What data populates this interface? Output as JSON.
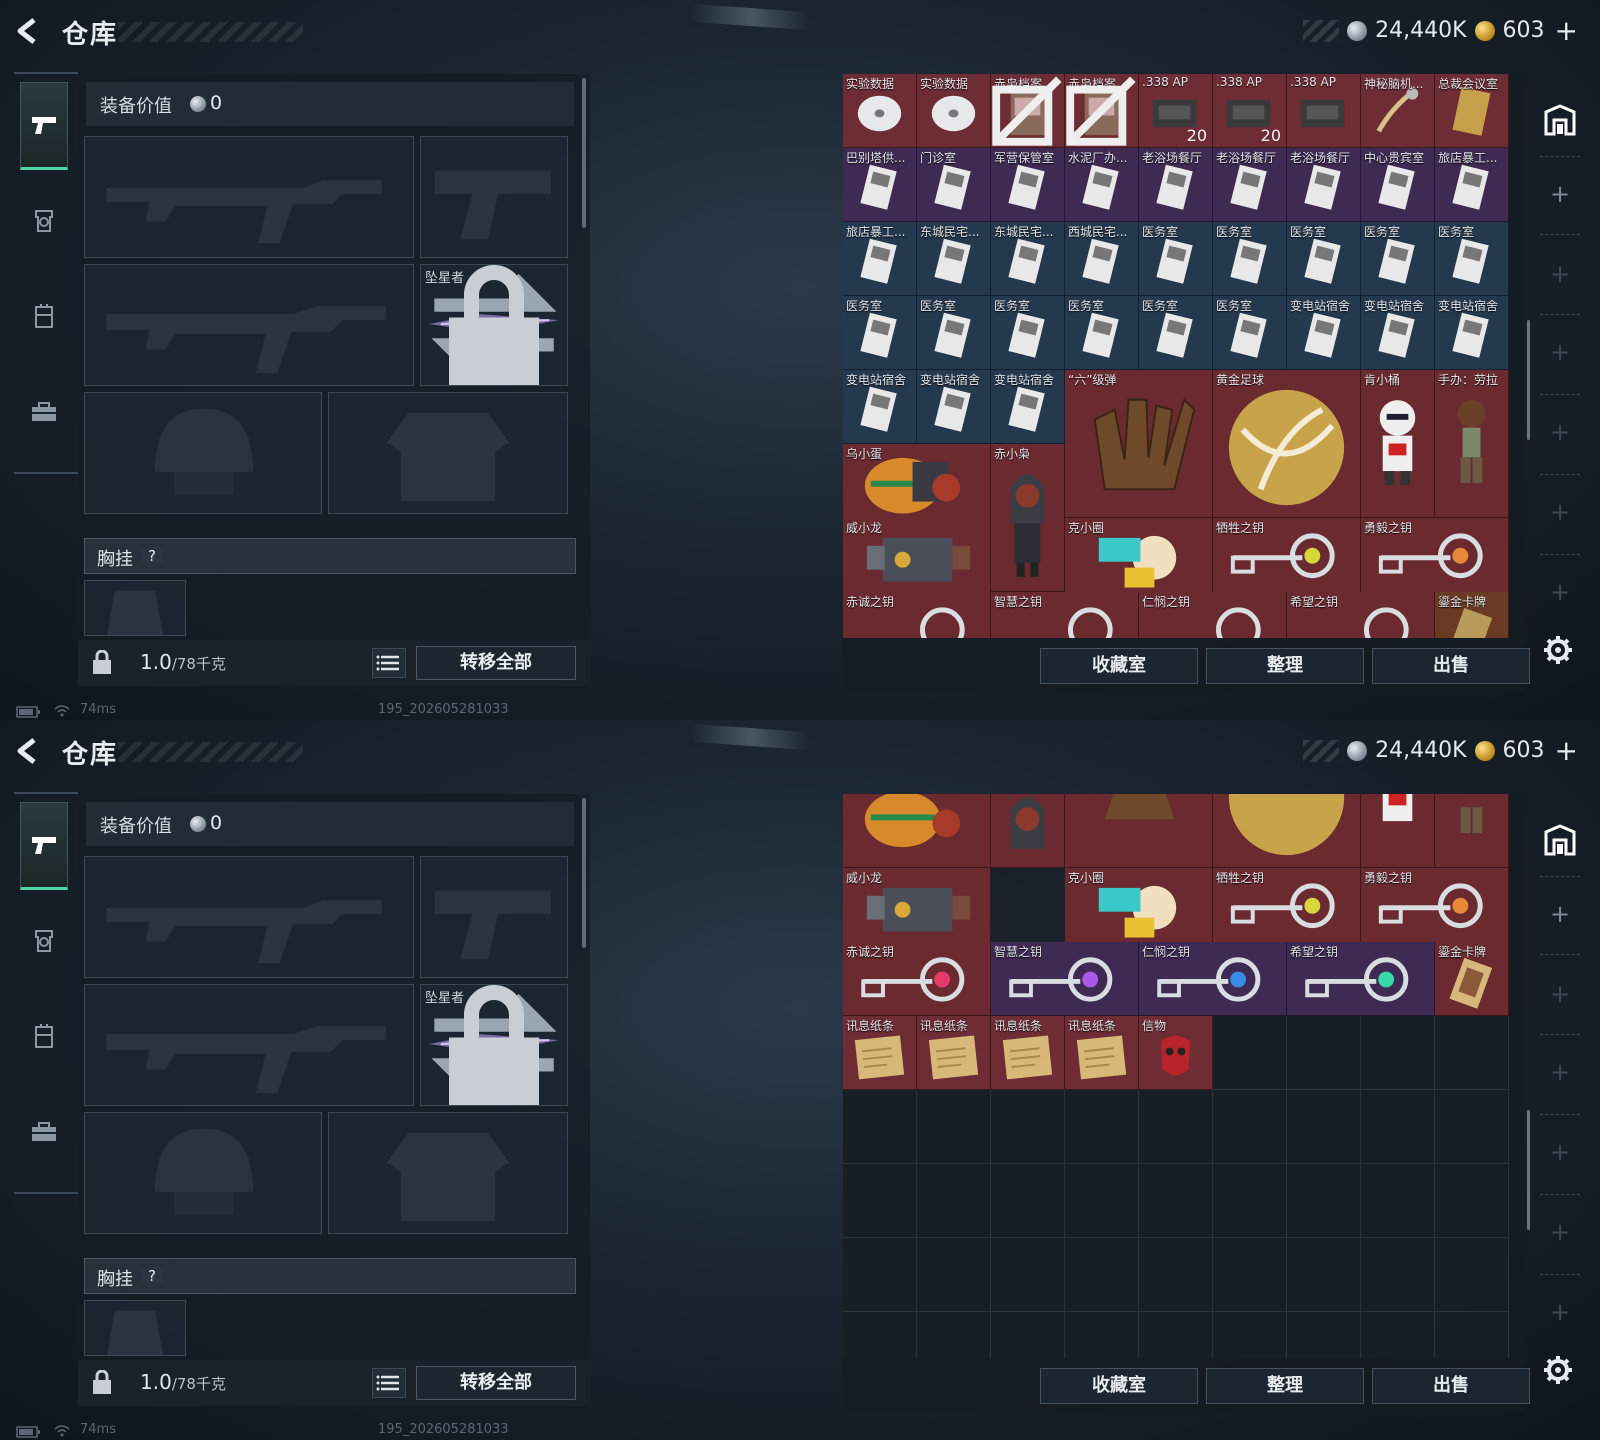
{
  "header": {
    "title": "仓库",
    "silver_amount": "24,440K",
    "gold_amount": "603",
    "add_label": "+"
  },
  "nav": {
    "tabs": [
      {
        "icon": "pistol-icon",
        "active": true
      },
      {
        "icon": "helmet-icon",
        "active": false
      },
      {
        "icon": "vest-icon",
        "active": false
      },
      {
        "icon": "toolbox-icon",
        "active": false
      }
    ]
  },
  "equip": {
    "value_label": "装备价值",
    "value": "0",
    "melee_name": "坠星者",
    "chest_label": "胸挂",
    "help": "?",
    "weight": "1.0",
    "weight_max": "/78千克",
    "transfer_label": "转移全部"
  },
  "stash_top": {
    "row1": [
      {
        "name": "实验数据",
        "qty": ""
      },
      {
        "name": "实验数据",
        "qty": ""
      },
      {
        "name": "赤枭档案",
        "qty": ""
      },
      {
        "name": "赤枭档案",
        "qty": ""
      },
      {
        "name": ".338 AP",
        "qty": "20"
      },
      {
        "name": ".338 AP",
        "qty": "20"
      },
      {
        "name": ".338 AP",
        "qty": ""
      },
      {
        "name": "神秘脑机...",
        "qty": ""
      },
      {
        "name": "总裁会议室",
        "qty": ""
      }
    ],
    "row2": [
      "巴别塔供...",
      "门诊室",
      "军营保管室",
      "水泥厂办...",
      "老浴场餐厅",
      "老浴场餐厅",
      "老浴场餐厅",
      "中心贵宾室",
      "旅店暴工..."
    ],
    "row3": [
      "旅店暴工...",
      "东城民宅...",
      "东城民宅...",
      "西城民宅...",
      "医务室",
      "医务室",
      "医务室",
      "医务室",
      "医务室"
    ],
    "row4": [
      "医务室",
      "医务室",
      "医务室",
      "医务室",
      "医务室",
      "医务室",
      "变电站宿舍",
      "变电站宿舍",
      "变电站宿舍"
    ],
    "row5": [
      "变电站宿舍",
      "变电站宿舍",
      "变电站宿舍"
    ],
    "liu": "“六”级弹",
    "ball": "黄金足球",
    "kfc": "肯小桶",
    "lara": "手办：劳拉",
    "egg": "乌小蛋",
    "owl": "赤小枭",
    "dragon": "威小龙",
    "circle": "克小圈",
    "key_sacrifice": "牺牲之钥",
    "key_courage": "勇毅之钥",
    "key_loyal": "赤诚之钥",
    "key_wisdom": "智慧之钥",
    "key_mercy": "仁悯之钥",
    "key_hope": "希望之钥",
    "card": "鎏金卡牌"
  },
  "stash_bottom": {
    "notes": [
      "讯息纸条",
      "讯息纸条",
      "讯息纸条",
      "讯息纸条"
    ],
    "token": "信物"
  },
  "buttons": {
    "collection": "收藏室",
    "sort": "整理",
    "sell": "出售"
  },
  "status": {
    "ping": "74ms",
    "build": "195_202605281033"
  }
}
